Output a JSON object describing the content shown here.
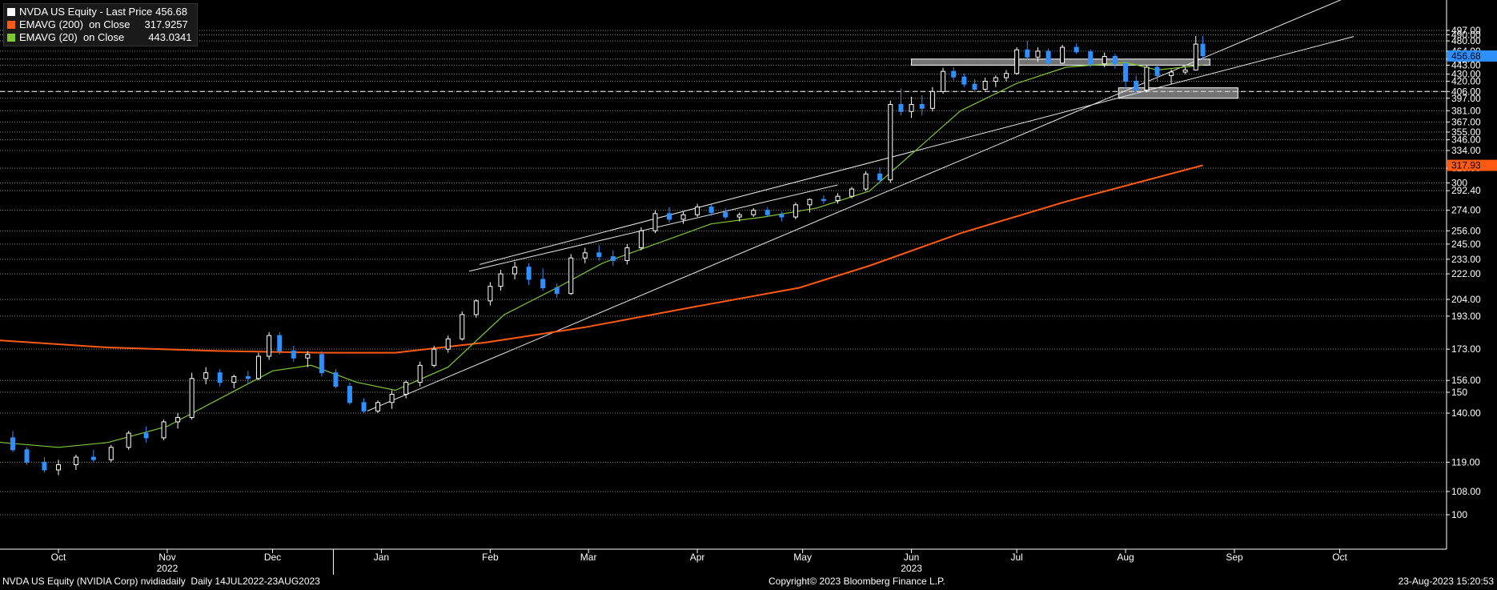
{
  "legend": {
    "items": [
      {
        "label": "NVDA US Equity - Last Price",
        "value": "456.68",
        "color": "#ffffff"
      },
      {
        "label": "EMAVG (200)  on Close",
        "value": "317.9257",
        "color": "#ff5a14"
      },
      {
        "label": "EMAVG (20)  on Close",
        "value": "443.0341",
        "color": "#7ec832"
      }
    ]
  },
  "footer": {
    "left": "NVDA US Equity (NVIDIA Corp) nvidiadaily  Daily 14JUL2022-23AUG2023",
    "center": "Copyright© 2023 Bloomberg Finance L.P.",
    "right": "23-Aug-2023 15:20:53"
  },
  "colors": {
    "up": "#ffffff",
    "down": "#2e8fff",
    "ema200": "#ff5a14",
    "ema20": "#7ec832",
    "grid": "#bbbbbb"
  },
  "chart_data": {
    "type": "line",
    "title": "NVDA US Equity - Last Price",
    "xlabel": "",
    "ylabel": "",
    "scale": "log",
    "ylim": [
      97,
      545
    ],
    "grid": true,
    "legend_position": "top-left",
    "month_ticks": [
      {
        "label": "Oct",
        "date": "2022-10-01"
      },
      {
        "label": "Nov",
        "date": "2022-11-01"
      },
      {
        "label": "Dec",
        "date": "2022-12-01"
      },
      {
        "label": "Jan",
        "date": "2023-01-01"
      },
      {
        "label": "Feb",
        "date": "2023-02-01"
      },
      {
        "label": "Mar",
        "date": "2023-03-01"
      },
      {
        "label": "Apr",
        "date": "2023-04-01"
      },
      {
        "label": "May",
        "date": "2023-05-01"
      },
      {
        "label": "Jun",
        "date": "2023-06-01"
      },
      {
        "label": "Jul",
        "date": "2023-07-01"
      },
      {
        "label": "Aug",
        "date": "2023-08-01"
      },
      {
        "label": "Sep",
        "date": "2023-09-01"
      },
      {
        "label": "Oct",
        "date": "2023-10-01"
      }
    ],
    "year_labels": [
      {
        "label": "2022",
        "date": "2022-11-01"
      },
      {
        "label": "2023",
        "date": "2023-06-01"
      }
    ],
    "y_ticks": [
      "497.00",
      "490.00",
      "480.00",
      "464.00",
      "452.00",
      "443.00",
      "430.00",
      "420.00",
      "406.00",
      "397.00",
      "381.00",
      "367.00",
      "355.00",
      "346.00",
      "334.00",
      "315.00",
      "300",
      "292.40",
      "274.00",
      "256.00",
      "245.00",
      "233.00",
      "222.00",
      "204.00",
      "193.00",
      "173.00",
      "156.00",
      "150",
      "140.00",
      "119.00",
      "108.00",
      "100"
    ],
    "last_price": {
      "value": 456.68,
      "label": "456.68",
      "color": "#2e8fff"
    },
    "ema200_tag": {
      "value": 317.93,
      "label": "317.93",
      "color": "#ff5a14"
    },
    "horizontal_lines": [
      {
        "value": 406,
        "style": "dashed"
      }
    ],
    "zones": [
      {
        "start": "2023-06-01",
        "end": "2023-08-25",
        "low": 443,
        "high": 452
      },
      {
        "start": "2023-07-30",
        "end": "2023-09-02",
        "low": 397,
        "high": 411
      }
    ],
    "trendlines": [
      {
        "start": "2022-12-28",
        "y0": 141,
        "end": "2023-10-05",
        "y1": 560
      },
      {
        "start": "2023-01-29",
        "y0": 229,
        "end": "2023-10-05",
        "y1": 487
      },
      {
        "start": "2023-01-26",
        "y0": 224,
        "end": "2023-05-11",
        "y1": 298
      }
    ],
    "candles": [
      [
        "2022-09-01",
        125,
        128,
        122,
        124
      ],
      [
        "2022-09-05",
        124,
        126,
        120,
        121
      ],
      [
        "2022-09-09",
        121,
        130,
        120,
        128
      ],
      [
        "2022-09-13",
        127,
        131,
        125,
        129
      ],
      [
        "2022-09-18",
        129,
        132,
        123,
        124
      ],
      [
        "2022-09-22",
        124,
        125,
        118,
        119
      ],
      [
        "2022-09-27",
        119,
        121,
        115,
        116
      ],
      [
        "2022-10-01",
        116,
        120,
        114,
        118
      ],
      [
        "2022-10-06",
        118,
        122,
        116,
        121
      ],
      [
        "2022-10-11",
        121,
        124,
        119,
        120
      ],
      [
        "2022-10-16",
        120,
        126,
        119,
        125
      ],
      [
        "2022-10-21",
        125,
        132,
        124,
        131
      ],
      [
        "2022-10-26",
        131,
        134,
        127,
        129
      ],
      [
        "2022-10-31",
        129,
        137,
        128,
        136
      ],
      [
        "2022-11-04",
        136,
        140,
        133,
        138
      ],
      [
        "2022-11-08",
        138,
        160,
        137,
        157
      ],
      [
        "2022-11-12",
        157,
        163,
        154,
        160
      ],
      [
        "2022-11-16",
        160,
        162,
        153,
        155
      ],
      [
        "2022-11-20",
        155,
        159,
        152,
        158
      ],
      [
        "2022-11-24",
        158,
        161,
        154,
        157
      ],
      [
        "2022-11-27",
        157,
        171,
        156,
        169
      ],
      [
        "2022-11-30",
        169,
        183,
        167,
        181
      ],
      [
        "2022-12-03",
        181,
        183,
        170,
        172
      ],
      [
        "2022-12-07",
        172,
        175,
        166,
        168
      ],
      [
        "2022-12-11",
        168,
        172,
        163,
        170
      ],
      [
        "2022-12-15",
        170,
        172,
        158,
        160
      ],
      [
        "2022-12-19",
        160,
        162,
        152,
        153
      ],
      [
        "2022-12-23",
        153,
        155,
        144,
        145
      ],
      [
        "2022-12-27",
        145,
        147,
        140,
        141
      ],
      [
        "2022-12-31",
        141,
        146,
        140,
        145
      ],
      [
        "2023-01-04",
        145,
        151,
        142,
        149
      ],
      [
        "2023-01-08",
        149,
        156,
        147,
        155
      ],
      [
        "2023-01-12",
        155,
        166,
        153,
        164
      ],
      [
        "2023-01-16",
        164,
        175,
        163,
        173
      ],
      [
        "2023-01-20",
        173,
        181,
        171,
        179
      ],
      [
        "2023-01-24",
        179,
        196,
        178,
        194
      ],
      [
        "2023-01-28",
        194,
        204,
        192,
        203
      ],
      [
        "2023-02-01",
        203,
        216,
        200,
        213
      ],
      [
        "2023-02-04",
        213,
        225,
        210,
        222
      ],
      [
        "2023-02-08",
        222,
        231,
        218,
        227
      ],
      [
        "2023-02-12",
        227,
        230,
        214,
        218
      ],
      [
        "2023-02-16",
        218,
        226,
        210,
        212
      ],
      [
        "2023-02-20",
        212,
        215,
        205,
        208
      ],
      [
        "2023-02-24",
        208,
        237,
        207,
        234
      ],
      [
        "2023-02-28",
        234,
        242,
        230,
        238
      ],
      [
        "2023-03-04",
        238,
        244,
        232,
        235
      ],
      [
        "2023-03-08",
        235,
        240,
        228,
        232
      ],
      [
        "2023-03-12",
        232,
        245,
        229,
        242
      ],
      [
        "2023-03-16",
        242,
        259,
        240,
        256
      ],
      [
        "2023-03-20",
        256,
        274,
        254,
        271
      ],
      [
        "2023-03-24",
        271,
        277,
        263,
        266
      ],
      [
        "2023-03-28",
        266,
        273,
        262,
        270
      ],
      [
        "2023-04-01",
        270,
        280,
        268,
        277
      ],
      [
        "2023-04-05",
        277,
        279,
        269,
        272
      ],
      [
        "2023-04-09",
        272,
        276,
        266,
        268
      ],
      [
        "2023-04-13",
        268,
        272,
        264,
        270
      ],
      [
        "2023-04-17",
        270,
        276,
        268,
        274
      ],
      [
        "2023-04-21",
        274,
        277,
        268,
        270
      ],
      [
        "2023-04-25",
        270,
        273,
        264,
        268
      ],
      [
        "2023-04-29",
        268,
        281,
        266,
        279
      ],
      [
        "2023-05-03",
        279,
        285,
        272,
        284
      ],
      [
        "2023-05-07",
        284,
        288,
        280,
        283
      ],
      [
        "2023-05-11",
        283,
        290,
        280,
        287
      ],
      [
        "2023-05-15",
        287,
        296,
        285,
        294
      ],
      [
        "2023-05-19",
        294,
        312,
        292,
        309
      ],
      [
        "2023-05-23",
        309,
        316,
        299,
        303
      ],
      [
        "2023-05-26",
        303,
        394,
        300,
        389
      ],
      [
        "2023-05-29",
        389,
        410,
        375,
        380
      ],
      [
        "2023-06-01",
        380,
        399,
        372,
        389
      ],
      [
        "2023-06-04",
        389,
        401,
        375,
        384
      ],
      [
        "2023-06-07",
        384,
        412,
        380,
        406
      ],
      [
        "2023-06-10",
        406,
        439,
        403,
        434
      ],
      [
        "2023-06-13",
        434,
        440,
        421,
        426
      ],
      [
        "2023-06-16",
        426,
        431,
        412,
        416
      ],
      [
        "2023-06-19",
        416,
        423,
        405,
        409
      ],
      [
        "2023-06-22",
        409,
        425,
        407,
        420
      ],
      [
        "2023-06-25",
        420,
        428,
        412,
        425
      ],
      [
        "2023-06-28",
        425,
        436,
        420,
        431
      ],
      [
        "2023-07-01",
        431,
        470,
        429,
        466
      ],
      [
        "2023-07-04",
        466,
        480,
        451,
        455
      ],
      [
        "2023-07-07",
        455,
        470,
        448,
        464
      ],
      [
        "2023-07-10",
        464,
        468,
        441,
        446
      ],
      [
        "2023-07-14",
        446,
        474,
        445,
        470
      ],
      [
        "2023-07-18",
        470,
        476,
        460,
        463
      ],
      [
        "2023-07-22",
        463,
        467,
        440,
        445
      ],
      [
        "2023-07-26",
        445,
        462,
        440,
        456
      ],
      [
        "2023-07-29",
        456,
        460,
        438,
        445
      ],
      [
        "2023-08-01",
        445,
        450,
        410,
        420
      ],
      [
        "2023-08-04",
        420,
        428,
        400,
        408
      ],
      [
        "2023-08-07",
        408,
        443,
        405,
        440
      ],
      [
        "2023-08-10",
        440,
        443,
        420,
        428
      ],
      [
        "2023-08-14",
        428,
        437,
        416,
        433
      ],
      [
        "2023-08-18",
        433,
        440,
        430,
        436
      ],
      [
        "2023-08-21",
        436,
        488,
        435,
        475
      ],
      [
        "2023-08-23",
        475,
        488,
        451,
        457
      ]
    ],
    "series": [
      {
        "name": "EMAVG (200)  on Close",
        "color": "#ff5a14",
        "points": [
          [
            "2022-07-14",
            189
          ],
          [
            "2022-08-15",
            183
          ],
          [
            "2022-09-15",
            178
          ],
          [
            "2022-10-15",
            174
          ],
          [
            "2022-11-15",
            172
          ],
          [
            "2022-12-15",
            171
          ],
          [
            "2023-01-05",
            171
          ],
          [
            "2023-01-31",
            177
          ],
          [
            "2023-02-28",
            186
          ],
          [
            "2023-03-31",
            199
          ],
          [
            "2023-04-30",
            212
          ],
          [
            "2023-05-20",
            228
          ],
          [
            "2023-06-15",
            254
          ],
          [
            "2023-07-15",
            282
          ],
          [
            "2023-08-23",
            318
          ]
        ]
      },
      {
        "name": "EMAVG (20)  on Close",
        "color": "#7ec832",
        "points": [
          [
            "2022-09-01",
            130
          ],
          [
            "2022-09-15",
            127
          ],
          [
            "2022-10-01",
            125
          ],
          [
            "2022-10-15",
            127
          ],
          [
            "2022-11-01",
            134
          ],
          [
            "2022-11-15",
            146
          ],
          [
            "2022-12-01",
            161
          ],
          [
            "2022-12-12",
            164
          ],
          [
            "2022-12-25",
            155
          ],
          [
            "2023-01-05",
            151
          ],
          [
            "2023-01-20",
            163
          ],
          [
            "2023-02-05",
            194
          ],
          [
            "2023-02-20",
            212
          ],
          [
            "2023-03-05",
            230
          ],
          [
            "2023-03-20",
            245
          ],
          [
            "2023-04-05",
            262
          ],
          [
            "2023-04-20",
            268
          ],
          [
            "2023-05-05",
            276
          ],
          [
            "2023-05-20",
            292
          ],
          [
            "2023-06-01",
            330
          ],
          [
            "2023-06-15",
            381
          ],
          [
            "2023-07-01",
            417
          ],
          [
            "2023-07-15",
            440
          ],
          [
            "2023-08-01",
            447
          ],
          [
            "2023-08-10",
            436
          ],
          [
            "2023-08-23",
            443
          ]
        ]
      }
    ]
  }
}
